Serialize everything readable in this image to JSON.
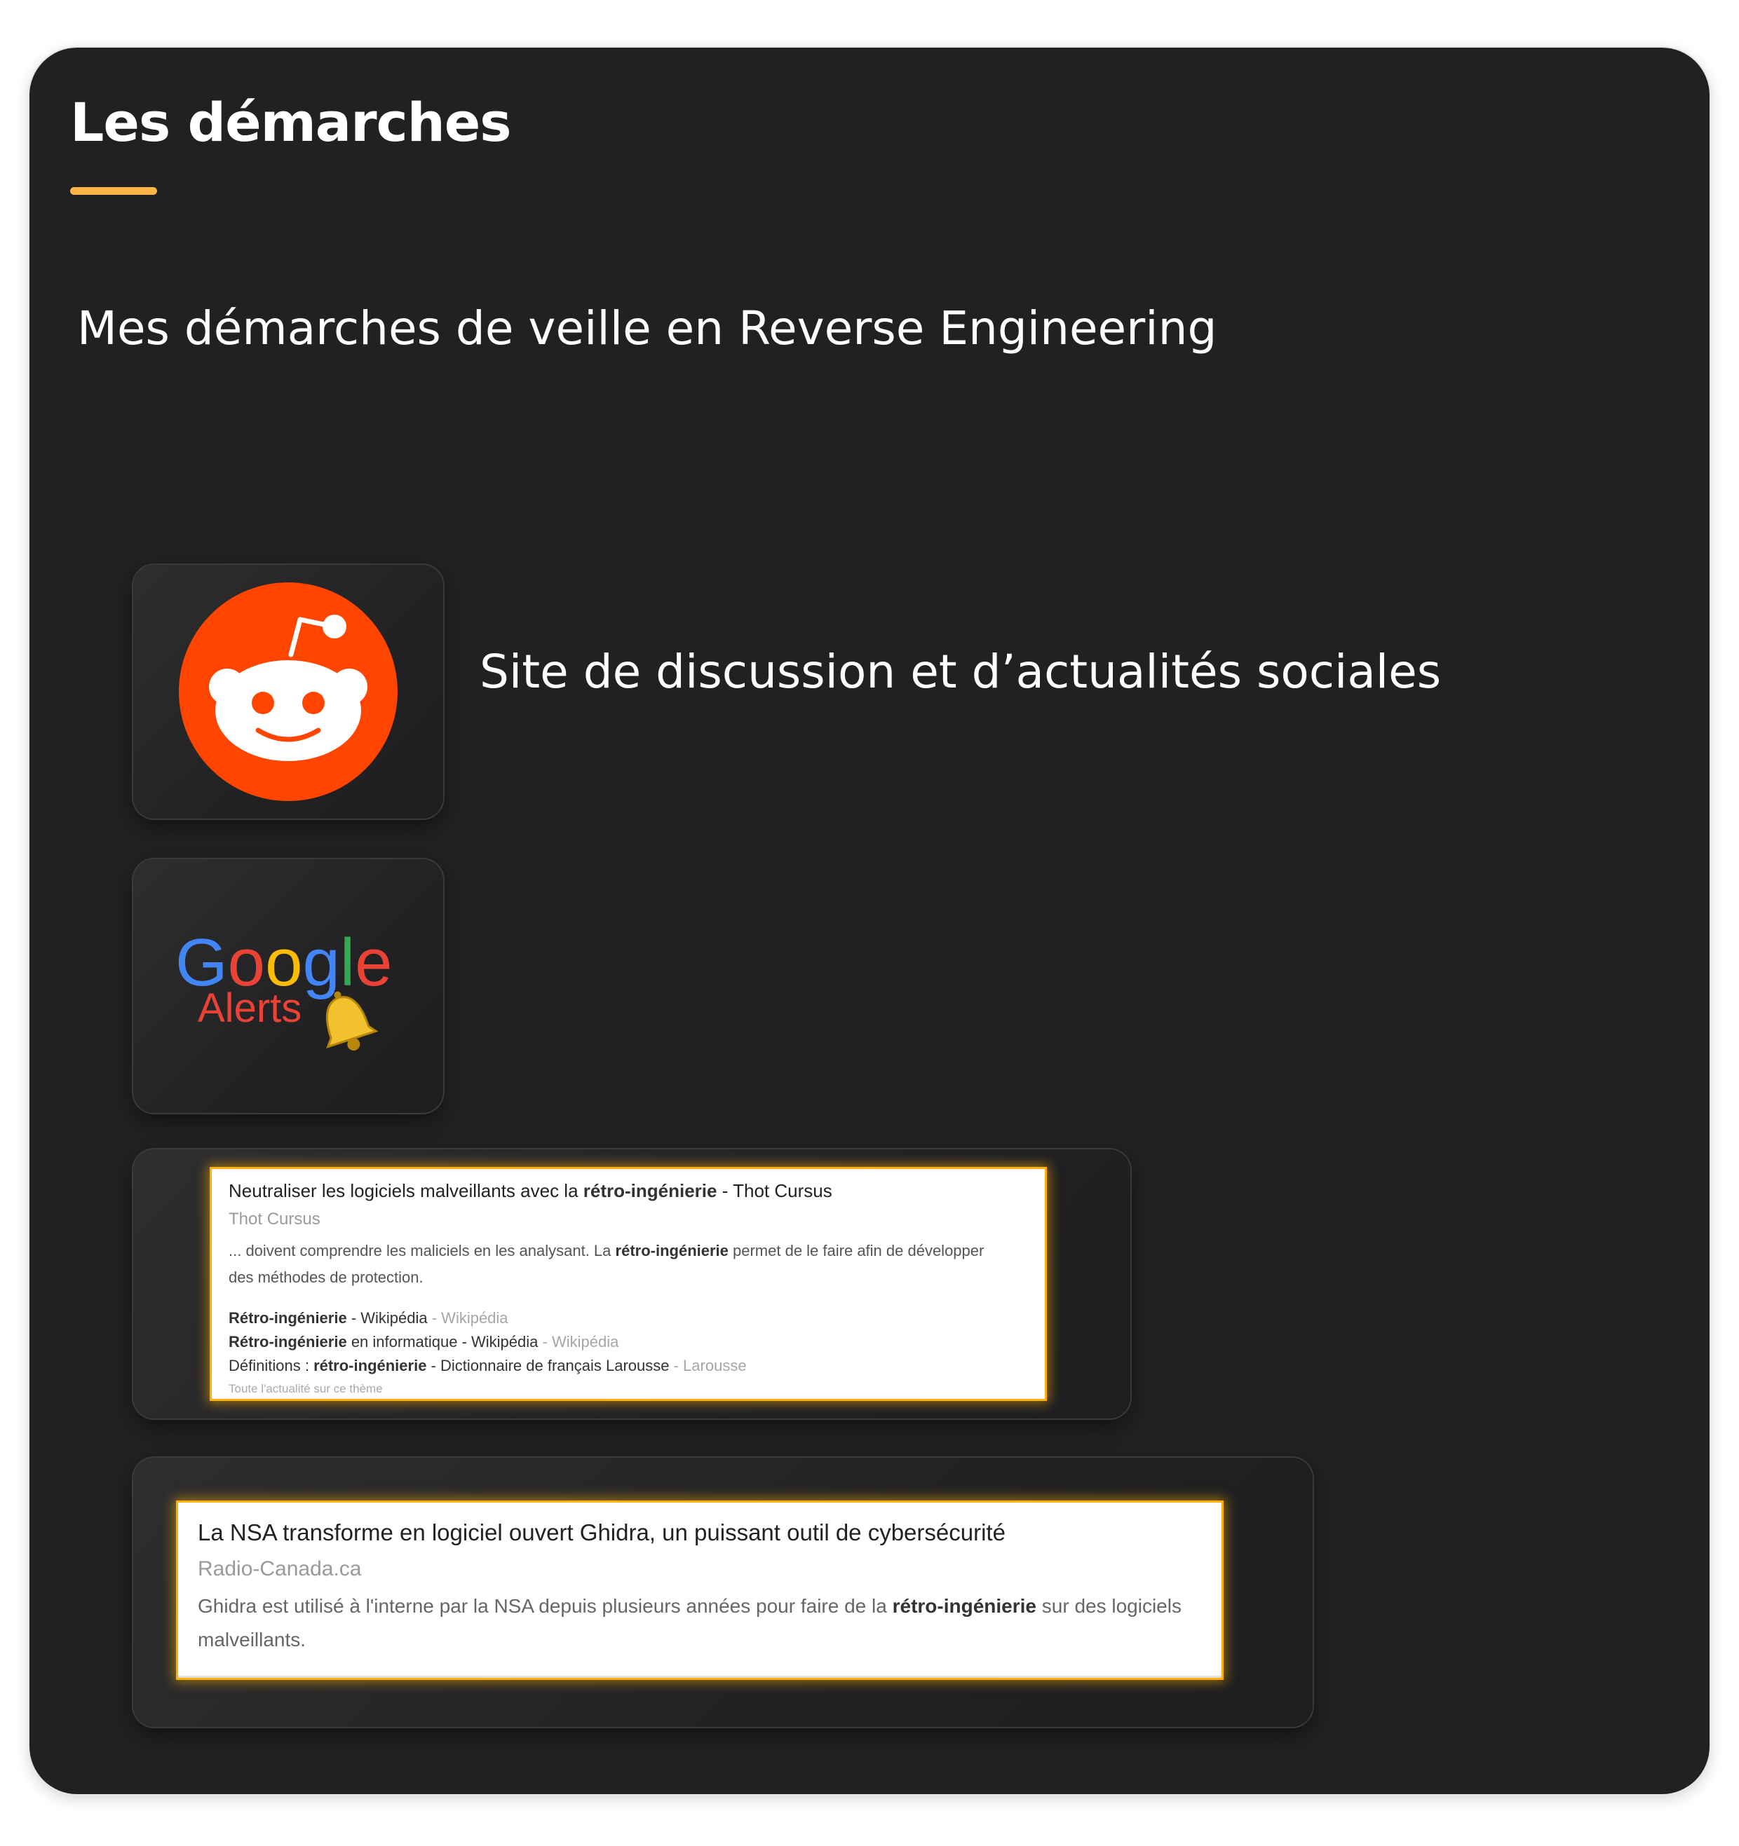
{
  "section": {
    "title": "Les démarches",
    "subtitle": "Mes démarches de veille en Reverse Engineering"
  },
  "colors": {
    "panel_bg": "#212123",
    "accent": "#ffb547",
    "reddit_orange": "#ff4500",
    "highlight_glow": "#ffb000"
  },
  "sources": [
    {
      "name": "Reddit",
      "icon": "reddit-logo-icon",
      "description": "Site de discussion et d’actualités sociales"
    },
    {
      "name": "Google Alerts",
      "icon": "google-alerts-logo-icon",
      "logo_text_top": "Google",
      "logo_text_bottom": "Alerts"
    }
  ],
  "alert_result_1": {
    "title_prefix": "Neutraliser les logiciels malveillants avec la ",
    "title_bold": "rétro-ingénierie",
    "title_suffix": " - Thot Cursus",
    "source": "Thot Cursus",
    "snippet_line1_a": "... doivent comprendre les maliciels en les analysant. La ",
    "snippet_line1_bold": "rétro-ingénierie",
    "snippet_line1_b": " permet de le faire afin de développer",
    "snippet_line2": "des méthodes de protection.",
    "links": [
      {
        "bold_pre": "Rétro-ingénierie",
        "text": " - Wikipédia",
        "source": " - Wikipédia"
      },
      {
        "bold_pre": "Rétro-ingénierie",
        "text": " en informatique - Wikipédia",
        "source": " - Wikipédia"
      },
      {
        "text_pre": "Définitions : ",
        "bold": "rétro-ingénierie",
        "text": " - Dictionnaire de français Larousse",
        "source": " - Larousse"
      }
    ],
    "footer": "Toute l'actualité sur ce thème"
  },
  "alert_result_2": {
    "title": "La NSA transforme en logiciel ouvert Ghidra, un puissant outil de cybersécurité",
    "source": "Radio-Canada.ca",
    "snippet_a": "Ghidra est utilisé à l'interne par la NSA depuis plusieurs années pour faire de la ",
    "snippet_bold": "rétro-ingénierie",
    "snippet_b": " sur des logiciels malveillants."
  }
}
